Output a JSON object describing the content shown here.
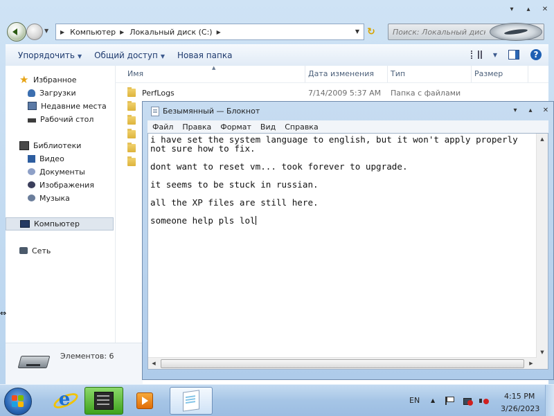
{
  "explorer": {
    "breadcrumb": [
      "Компьютер",
      "Локальный диск (C:)"
    ],
    "search_placeholder": "Поиск: Локальный диск (C:)",
    "toolbar": {
      "organize": "Упорядочить",
      "share": "Общий доступ",
      "new_folder": "Новая папка"
    },
    "nav": {
      "favorites": "Избранное",
      "downloads": "Загрузки",
      "recent": "Недавние места",
      "desktop": "Рабочий стол",
      "libraries": "Библиотеки",
      "video": "Видео",
      "documents": "Документы",
      "pictures": "Изображения",
      "music": "Музыка",
      "computer": "Компьютер",
      "network": "Сеть"
    },
    "columns": {
      "name": "Имя",
      "date": "Дата изменения",
      "type": "Тип",
      "size": "Размер"
    },
    "files": [
      {
        "name": "PerfLogs",
        "date": "7/14/2009 5:37 AM",
        "type": "Папка с файлами",
        "size": ""
      }
    ],
    "details": "Элементов: 6"
  },
  "notepad": {
    "title": "Безымянный — Блокнот",
    "menu": [
      "Файл",
      "Правка",
      "Формат",
      "Вид",
      "Справка"
    ],
    "text": "i have set the system language to english, but it won't apply properly\nnot sure how to fix.\n\ndont want to reset vm... took forever to upgrade.\n\nit seems to be stuck in russian.\n\nall the XP files are still here.\n\nsomeone help pls lol"
  },
  "taskbar": {
    "language": "EN",
    "time": "4:15 PM",
    "date": "3/26/2023"
  },
  "icons": {
    "start": "windows-start-orb",
    "ie": "internet-explorer-icon",
    "explorer": "file-cabinet-icon",
    "media": "media-player-icon",
    "notepad": "notepad-icon"
  },
  "colors": {
    "link_blue": "#1e3a6e",
    "window_frame": "#b9d4ee",
    "taskbar": "#a6c5e6",
    "active_app": "#3ea21c"
  }
}
